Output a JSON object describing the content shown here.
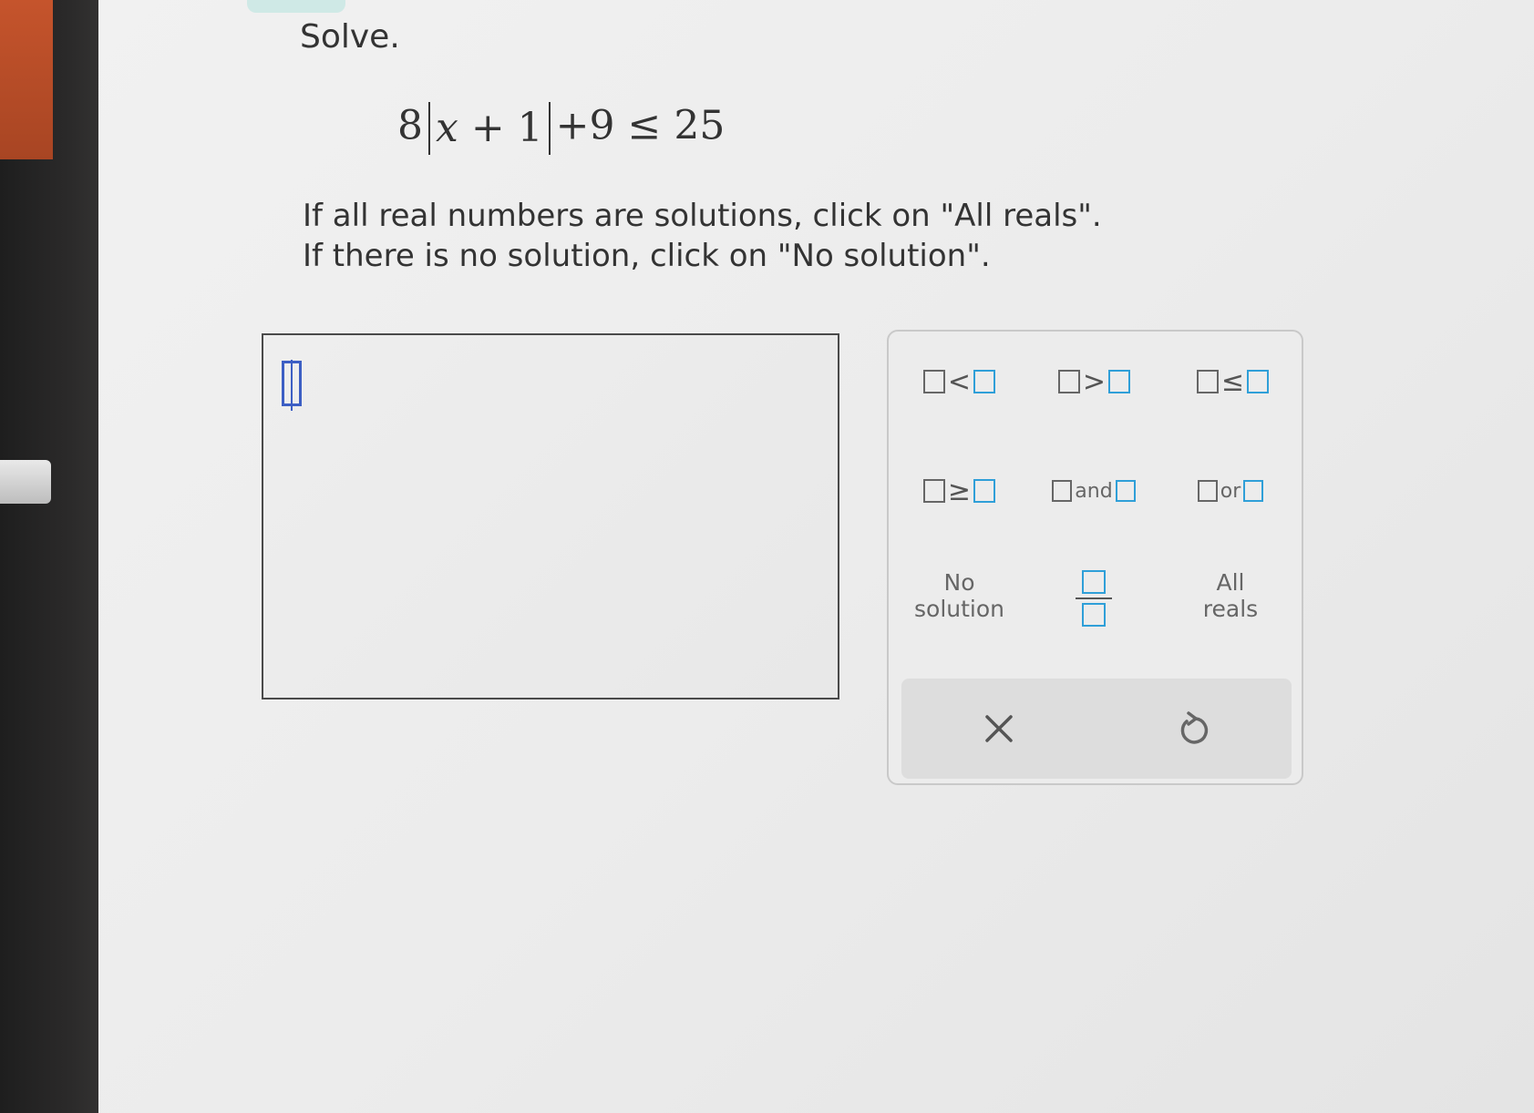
{
  "prompt": {
    "solve_label": "Solve.",
    "equation": {
      "coefficient": "8",
      "abs_variable": "x",
      "abs_rest": " + 1",
      "tail": "+9 ≤ 25"
    },
    "instruction_line1": "If all real numbers are solutions, click on \"All reals\".",
    "instruction_line2": "If there is no solution, click on \"No solution\"."
  },
  "keypad": {
    "keys": [
      {
        "id": "less-than",
        "op": "<"
      },
      {
        "id": "greater-than",
        "op": ">"
      },
      {
        "id": "less-equal",
        "op": "≤"
      },
      {
        "id": "greater-equal",
        "op": "≥"
      },
      {
        "id": "and",
        "word": "and"
      },
      {
        "id": "or",
        "word": "or"
      }
    ],
    "no_solution": {
      "line1": "No",
      "line2": "solution"
    },
    "all_reals": {
      "line1": "All",
      "line2": "reals"
    },
    "clear_icon": "x-icon",
    "undo_icon": "undo-icon"
  },
  "colors": {
    "accent_blue": "#2f9fd8",
    "cursor_blue": "#3d5fc4"
  }
}
